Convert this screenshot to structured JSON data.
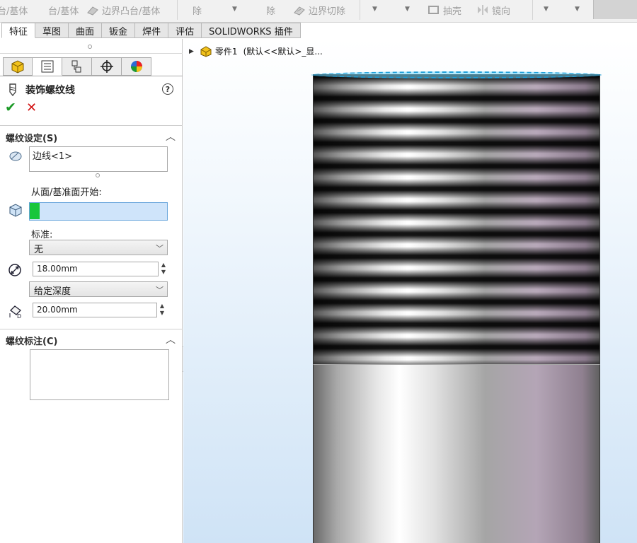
{
  "toolbar": {
    "item1": "台/基体",
    "item2": "台/基体",
    "item3": "边界凸台/基体",
    "item4": "除",
    "item5": "除",
    "item6": "边界切除",
    "item7": "抽壳",
    "item8": "镜向"
  },
  "tabs": [
    {
      "label": "特征"
    },
    {
      "label": "草图"
    },
    {
      "label": "曲面"
    },
    {
      "label": "钣金"
    },
    {
      "label": "焊件"
    },
    {
      "label": "评估"
    },
    {
      "label": "SOLIDWORKS 插件"
    }
  ],
  "property_manager": {
    "title": "装饰螺纹线",
    "help": "?",
    "ok": "✔",
    "cancel": "✕",
    "thread_settings": {
      "header": "螺纹设定(S)",
      "edge_value": "边线<1>",
      "start_label": "从面/基准面开始:",
      "standard_label": "标准:",
      "standard_value": "无",
      "diameter": "18.00mm",
      "end_condition": "给定深度",
      "depth": "20.00mm"
    },
    "thread_callout": {
      "header": "螺纹标注(C)",
      "value": ""
    }
  },
  "viewport": {
    "tree_part": "零件1",
    "tree_config": "(默认<<默认>_显..."
  }
}
